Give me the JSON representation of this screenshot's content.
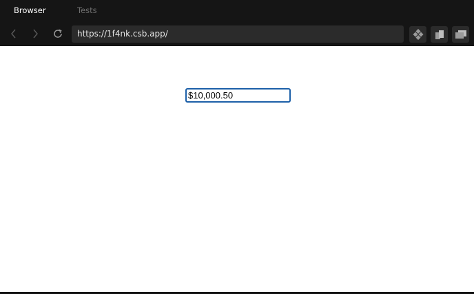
{
  "tabs": [
    {
      "label": "Browser",
      "active": true
    },
    {
      "label": "Tests",
      "active": false
    }
  ],
  "navigation": {
    "back_icon": "chevron-left-icon",
    "forward_icon": "chevron-right-icon",
    "refresh_icon": "refresh-icon",
    "url": "https://1f4nk.csb.app/"
  },
  "toolbar": {
    "icons": [
      "codesandbox-logo-icon",
      "open-new-window-icon",
      "devtools-icon"
    ]
  },
  "page": {
    "amount_value": "$10,000.50"
  },
  "colors": {
    "chrome_background": "#151515",
    "address_background": "#2b2b2b",
    "input_focus_border": "#1b5fa8"
  }
}
